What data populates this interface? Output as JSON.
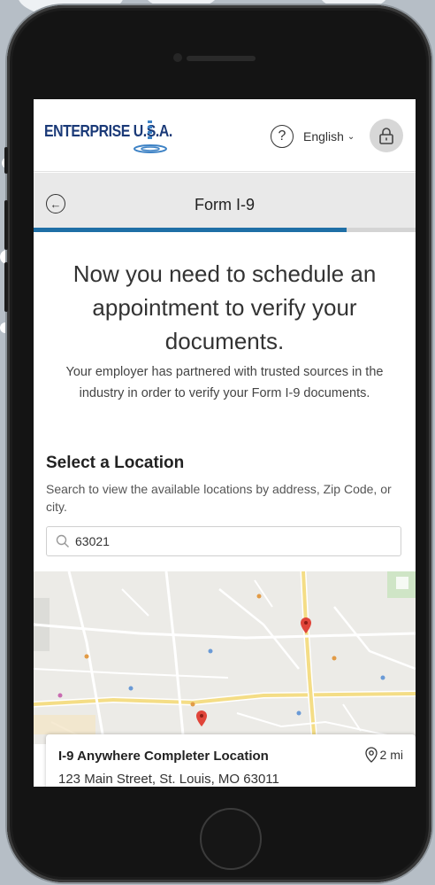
{
  "header": {
    "logo_text": "ENTERPRISE",
    "logo_suffix": "U.S.A.",
    "language": "English"
  },
  "title_bar": {
    "title": "Form I-9"
  },
  "progress": {
    "fraction": 0.82
  },
  "main": {
    "headline": "Now you need to schedule an appointment to verify your documents.",
    "subtext": "Your employer has partnered with trusted sources in the industry in order to verify your Form I-9 documents."
  },
  "location": {
    "title": "Select a Location",
    "description": "Search to view the available locations by address, Zip Code, or city.",
    "search_value": "63021"
  },
  "result": {
    "name": "I-9 Anywhere Completer Location",
    "distance": "2 mi",
    "address": "123 Main Street, St. Louis, MO 63011"
  },
  "colors": {
    "brand": "#1b3a78",
    "progress": "#1f6fa6",
    "map_pin": "#e0453a",
    "background": "#b6bec6"
  }
}
